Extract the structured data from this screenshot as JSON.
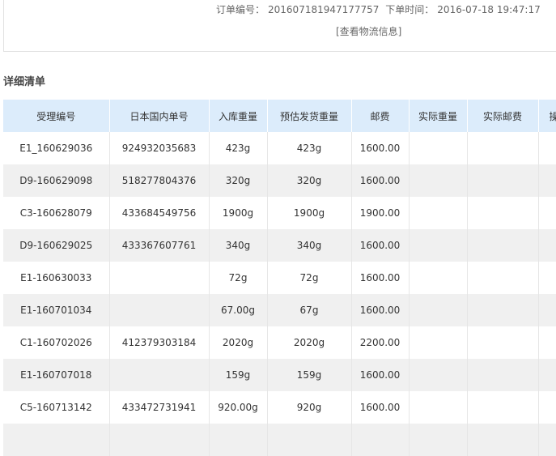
{
  "order": {
    "order_no_label": "订单编号：",
    "order_no": "201607181947177757",
    "order_time_label": "下单时间：",
    "order_time": "2016-07-18 19:47:17",
    "logistics_link": "[查看物流信息]"
  },
  "section_title": "详细清单",
  "table": {
    "headers": [
      "受理编号",
      "日本国内单号",
      "入库重量",
      "预估发货重量",
      "邮费",
      "实际重量",
      "实际邮费",
      "操"
    ],
    "rows": [
      [
        "E1_160629036",
        "924932035683",
        "423g",
        "423g",
        "1600.00",
        "",
        "",
        ""
      ],
      [
        "D9-160629098",
        "518277804376",
        "320g",
        "320g",
        "1600.00",
        "",
        "",
        ""
      ],
      [
        "C3-160628079",
        "433684549756",
        "1900g",
        "1900g",
        "1900.00",
        "",
        "",
        ""
      ],
      [
        "D9-160629025",
        "433367607761",
        "340g",
        "340g",
        "1600.00",
        "",
        "",
        ""
      ],
      [
        "E1-160630033",
        "",
        "72g",
        "72g",
        "1600.00",
        "",
        "",
        ""
      ],
      [
        "E1-160701034",
        "",
        "67.00g",
        "67g",
        "1600.00",
        "",
        "",
        ""
      ],
      [
        "C1-160702026",
        "412379303184",
        "2020g",
        "2020g",
        "2200.00",
        "",
        "",
        ""
      ],
      [
        "E1-160707018",
        "",
        "159g",
        "159g",
        "1600.00",
        "",
        "",
        ""
      ],
      [
        "C5-160713142",
        "433472731941",
        "920.00g",
        "920g",
        "1600.00",
        "",
        "",
        ""
      ],
      [
        "",
        "",
        "",
        "",
        "",
        "",
        "",
        ""
      ]
    ]
  }
}
